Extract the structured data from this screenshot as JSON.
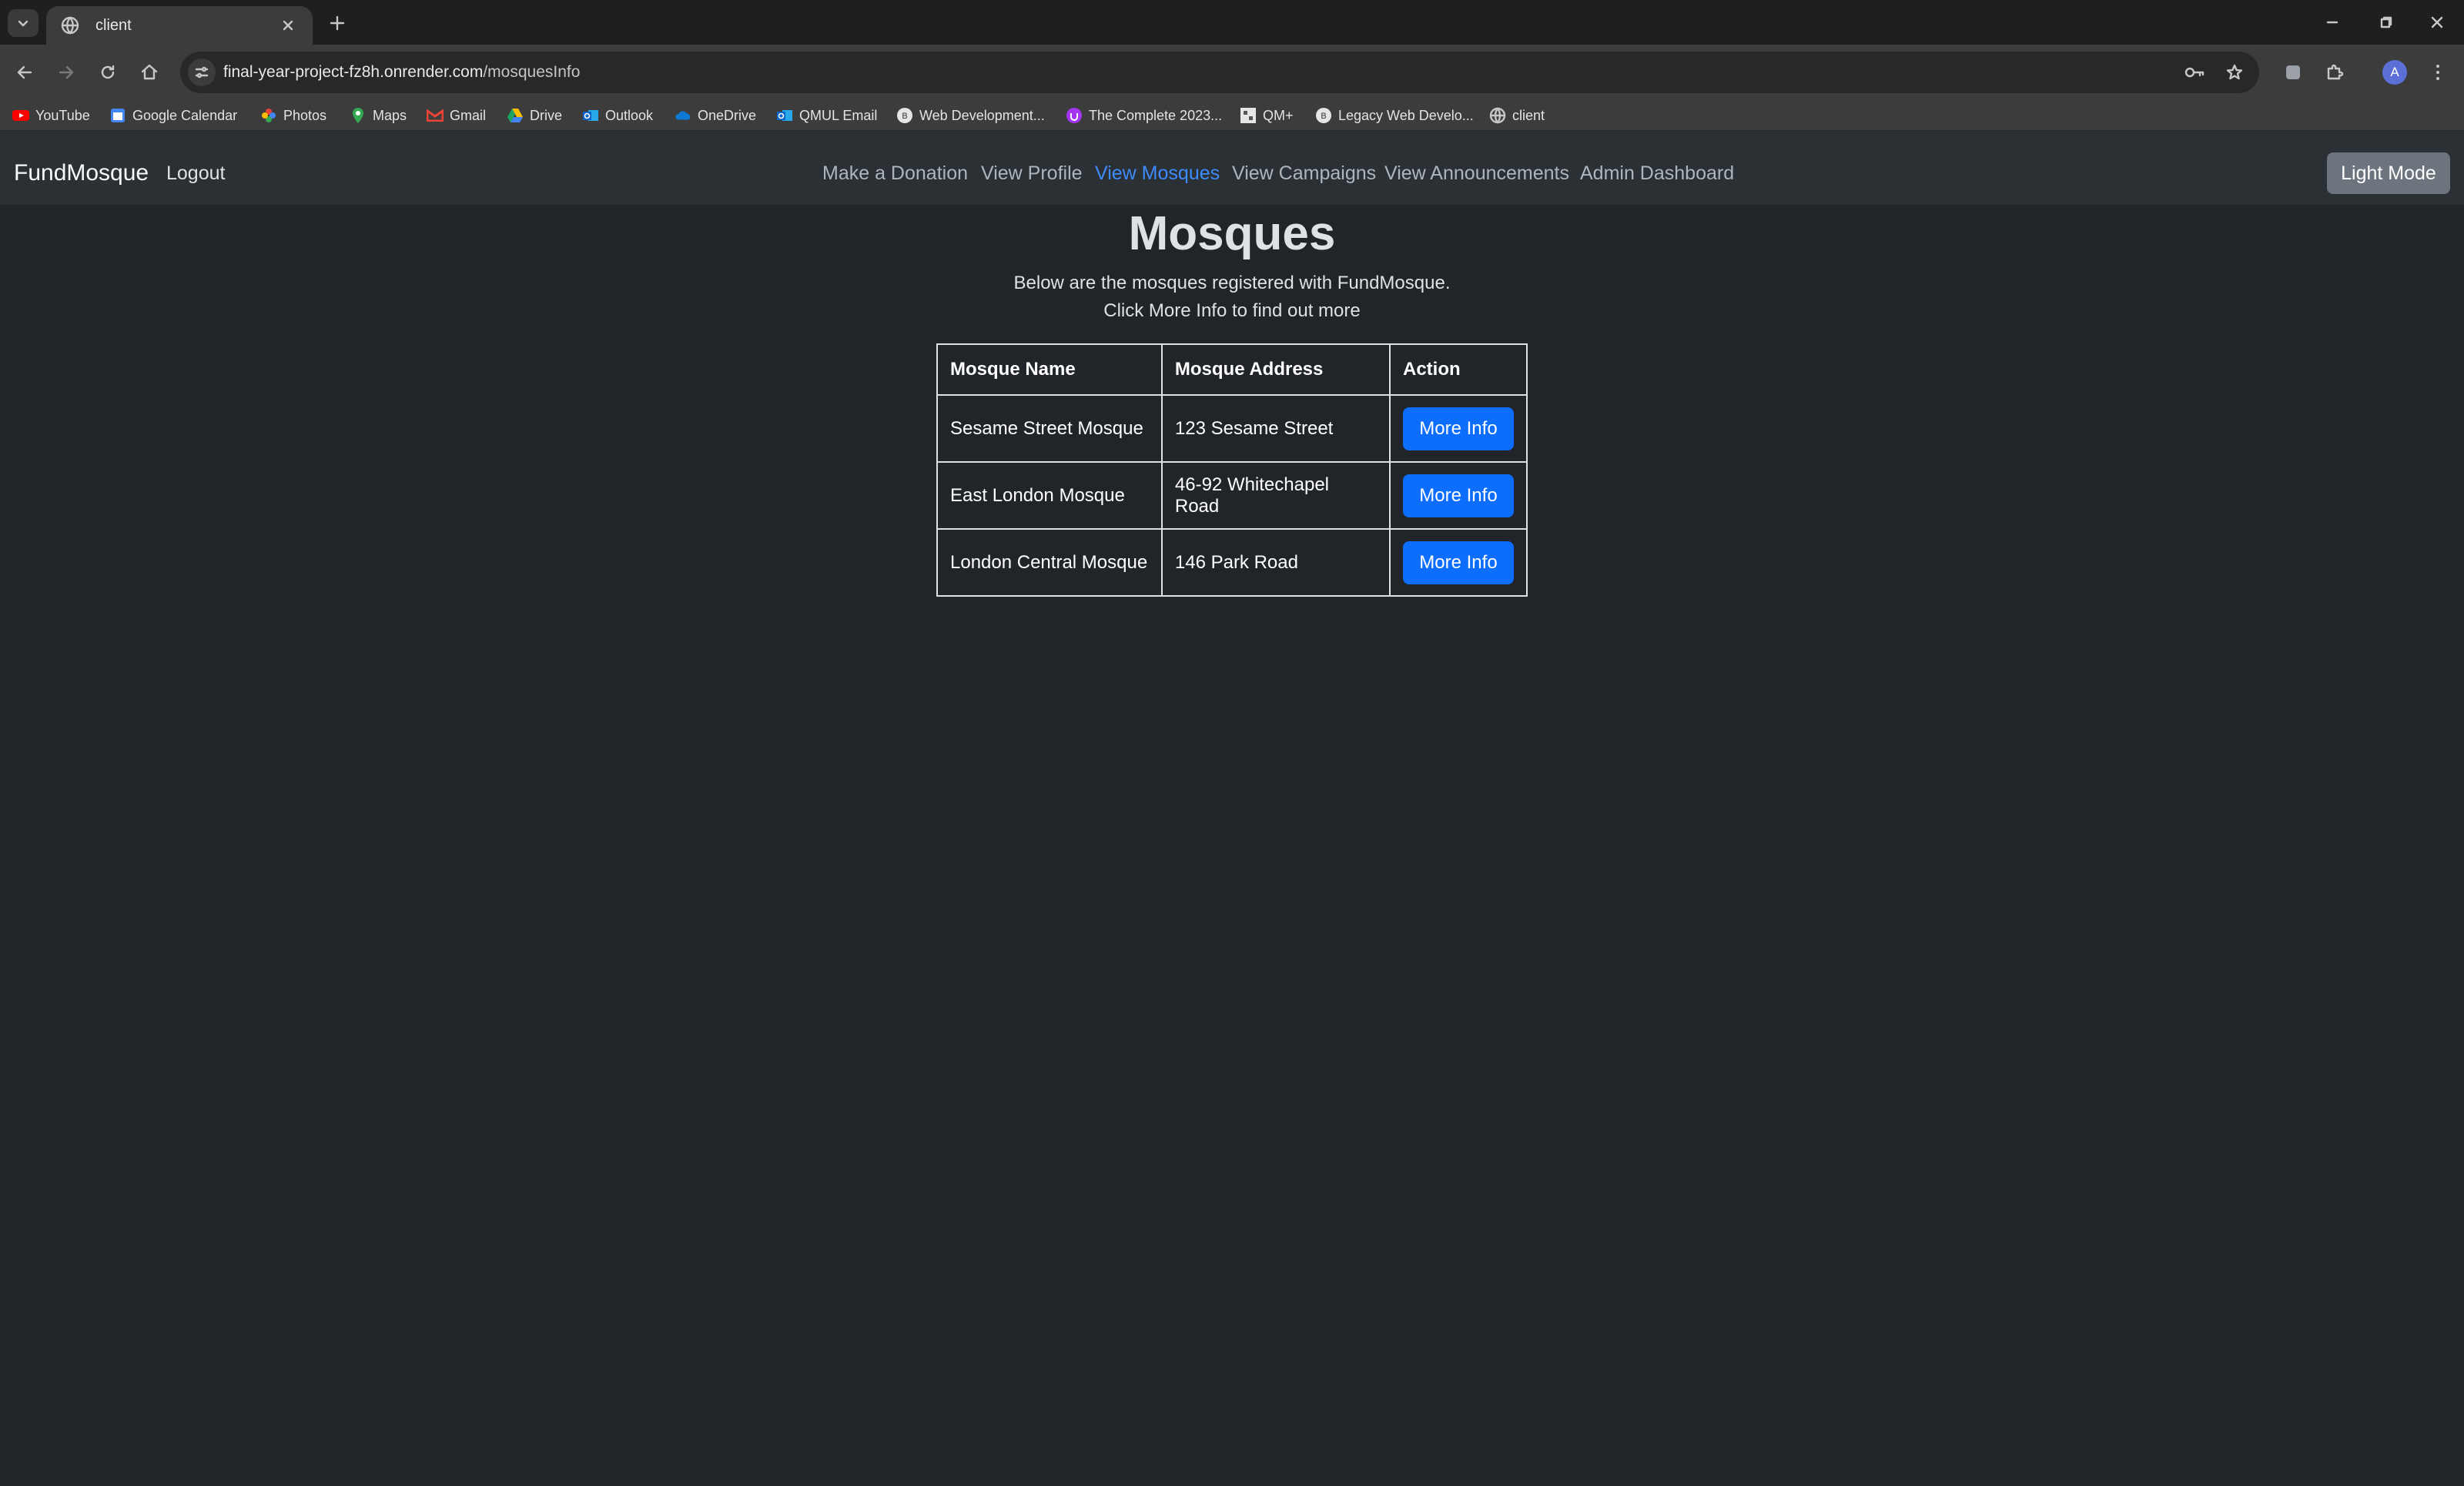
{
  "browser": {
    "tab_title": "client",
    "url_host": "final-year-project-fz8h.onrender.com",
    "url_path": "/mosquesInfo",
    "bookmarks": [
      {
        "label": "YouTube",
        "icon": "youtube-icon",
        "color": "#ff0000"
      },
      {
        "label": "Google Calendar",
        "icon": "calendar-icon",
        "color": "#4285f4"
      },
      {
        "label": "Photos",
        "icon": "photos-icon",
        "color": "#fbbc04"
      },
      {
        "label": "Maps",
        "icon": "maps-icon",
        "color": "#34a853"
      },
      {
        "label": "Gmail",
        "icon": "gmail-icon",
        "color": "#ea4335"
      },
      {
        "label": "Drive",
        "icon": "drive-icon",
        "color": "#1fa463"
      },
      {
        "label": "Outlook",
        "icon": "outlook-icon",
        "color": "#0a64c8"
      },
      {
        "label": "OneDrive",
        "icon": "onedrive-icon",
        "color": "#0f78d4"
      },
      {
        "label": "QMUL Email",
        "icon": "outlook-icon",
        "color": "#0a64c8"
      },
      {
        "label": "Web Development...",
        "icon": "course-icon",
        "color": "#e6e6e6"
      },
      {
        "label": "The Complete 2023...",
        "icon": "udemy-icon",
        "color": "#a435f0"
      },
      {
        "label": "QM+",
        "icon": "qm-icon",
        "color": "#e6e6e6"
      },
      {
        "label": "Legacy Web Develo...",
        "icon": "course-icon",
        "color": "#e6e6e6"
      },
      {
        "label": "client",
        "icon": "globe-icon",
        "color": "#c7c7c7"
      }
    ],
    "avatar_letter": "A"
  },
  "nav": {
    "brand": "FundMosque",
    "logout": "Logout",
    "links": [
      {
        "label": "Make a Donation",
        "active": false
      },
      {
        "label": "View Profile",
        "active": false
      },
      {
        "label": "View Mosques",
        "active": true
      },
      {
        "label": "View Campaigns",
        "active": false
      },
      {
        "label": "View Announcements",
        "active": false
      },
      {
        "label": "Admin Dashboard",
        "active": false
      }
    ],
    "theme_button": "Light Mode",
    "active_color": "#3d8bfd"
  },
  "main": {
    "title": "Mosques",
    "subtitle_line1": "Below are the mosques registered with FundMosque.",
    "subtitle_line2": "Click More Info to find out more",
    "table": {
      "headers": [
        "Mosque Name",
        "Mosque Address",
        "Action"
      ],
      "rows": [
        {
          "name": "Sesame Street Mosque",
          "address": "123 Sesame Street",
          "action": "More Info"
        },
        {
          "name": "East London Mosque",
          "address": "46-92 Whitechapel Road",
          "action": "More Info"
        },
        {
          "name": "London Central Mosque",
          "address": "146 Park Road",
          "action": "More Info"
        }
      ]
    },
    "button_color": "#0d6efd",
    "background_color": "#212529"
  }
}
